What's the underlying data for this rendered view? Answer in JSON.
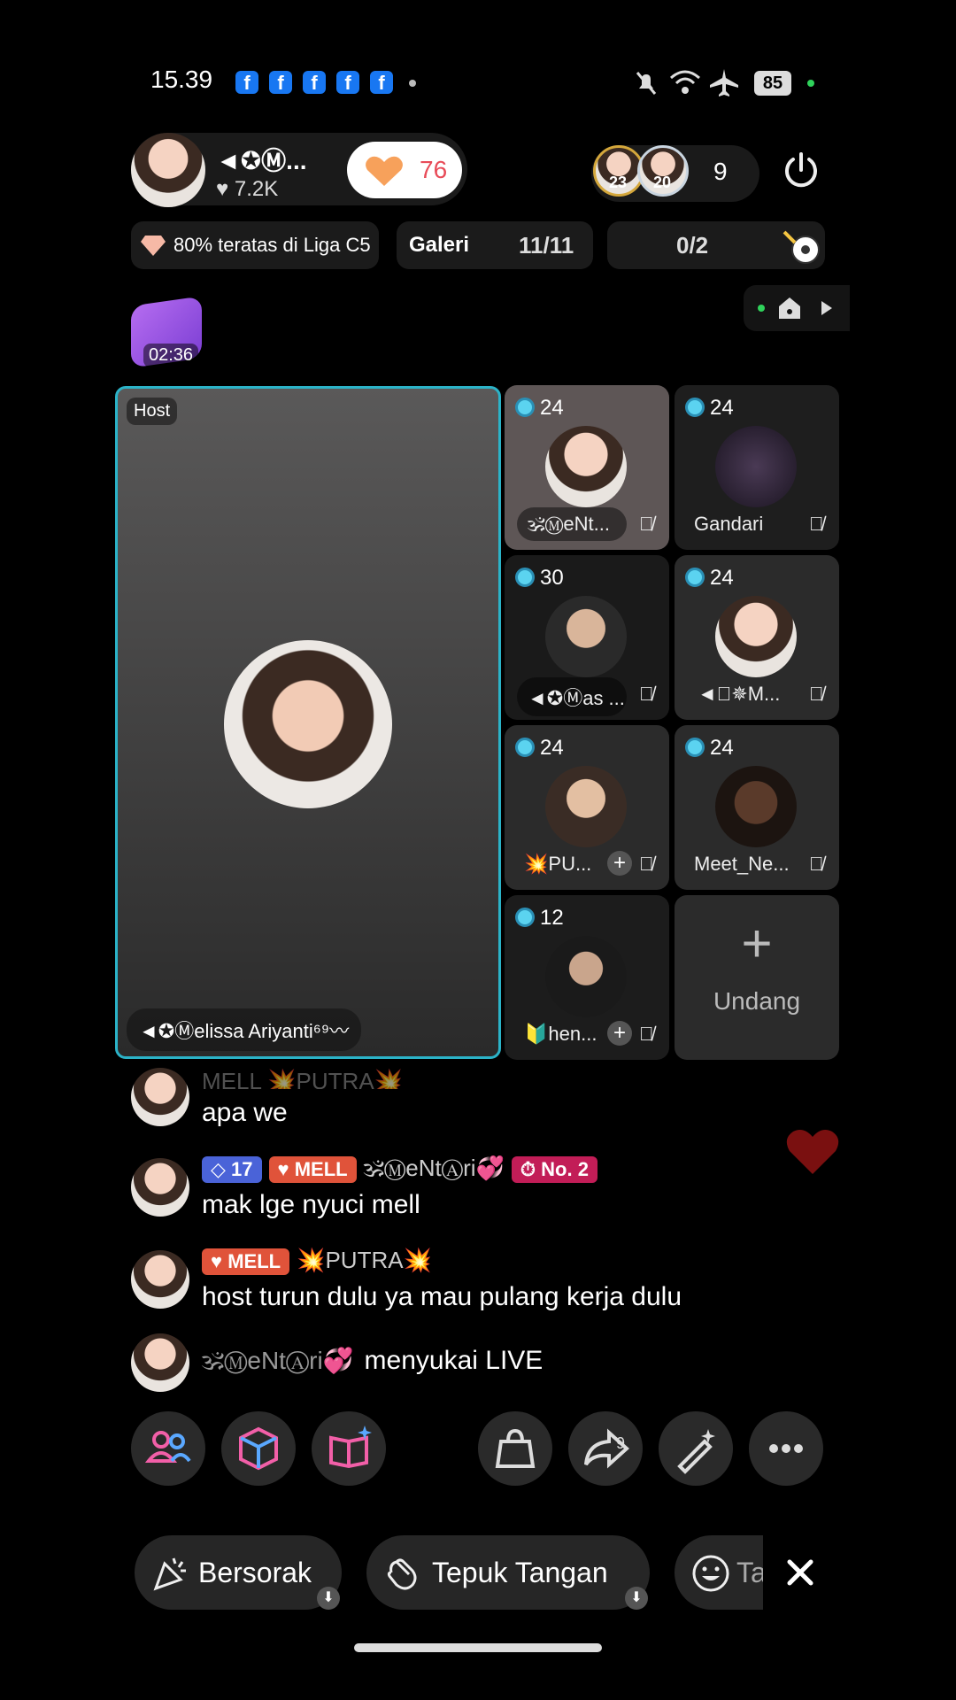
{
  "status_bar": {
    "time": "15.39",
    "fb_icon_glyph": "f",
    "battery": "85"
  },
  "host_header": {
    "host_name": "◄✪Ⓜ...",
    "likes": "♥ 7.2K",
    "like_pill_count": "76",
    "viewer_avatar_1_level": "23",
    "viewer_avatar_2_level": "20",
    "viewer_count": "9"
  },
  "chips": {
    "league": "80% teratas di Liga C5",
    "gallery_label": "Galeri",
    "gallery_count": "11/11",
    "match_count": "0/2"
  },
  "gift_box": {
    "timer": "02:36"
  },
  "host_tile": {
    "badge": "Host",
    "name": "◄✪Ⓜelissa Ariyanti⁶⁹〰"
  },
  "guests": [
    {
      "count": "24",
      "name": "🕉ⓂeNt..."
    },
    {
      "count": "24",
      "name": "Gandari"
    },
    {
      "count": "30",
      "name": "◄✪Ⓜas ..."
    },
    {
      "count": "24",
      "name": "◄꙰✵M..."
    },
    {
      "count": "24",
      "name": "💥PU..."
    },
    {
      "count": "24",
      "name": "Meet_Ne..."
    },
    {
      "count": "12",
      "name": "🔰hen..."
    }
  ],
  "invite_label": "Undang",
  "chat": [
    {
      "badges_line": "MELL  💥PUTRA💥",
      "text": "apa we"
    },
    {
      "level": "17",
      "fan": "MELL",
      "user": "🕉ⓂeNtⒶri💞",
      "rank": "No. 2",
      "text": "mak lge nyuci mell"
    },
    {
      "fan": "MELL",
      "user": "💥PUTRA💥",
      "text": "host turun dulu ya mau pulang kerja dulu"
    },
    {
      "user": "🕉ⓂeNtⒶri💞",
      "text": "menyukai LIVE"
    }
  ],
  "toolbar": {
    "share_count": "9"
  },
  "reactions": {
    "cheer": "Bersorak",
    "clap": "Tepuk Tangan",
    "third": "Ta"
  }
}
